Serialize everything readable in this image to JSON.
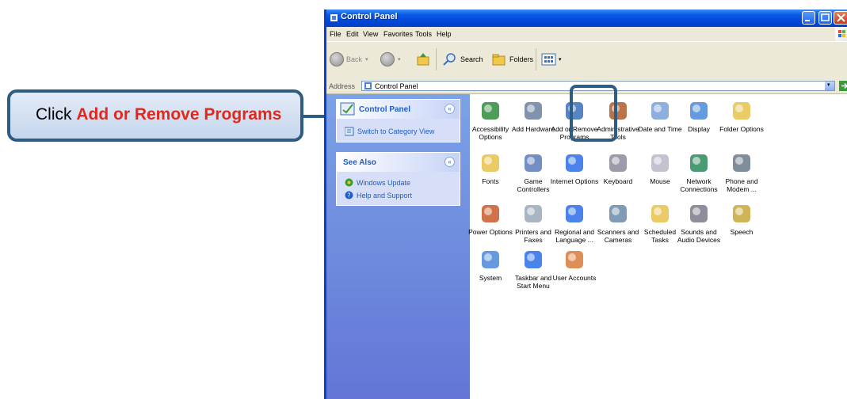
{
  "window": {
    "title": "Control Panel",
    "menus": [
      "File",
      "Edit",
      "View",
      "Favorites",
      "Tools",
      "Help"
    ],
    "toolbar": {
      "back": "Back",
      "search": "Search",
      "folders": "Folders"
    },
    "address": {
      "label": "Address",
      "value": "Control Panel",
      "go": "Go"
    }
  },
  "sidebar": {
    "control_panel": {
      "title": "Control Panel",
      "link": "Switch to Category View"
    },
    "see_also": {
      "title": "See Also",
      "links": [
        "Windows Update",
        "Help and Support"
      ]
    }
  },
  "items": [
    {
      "label": "Accessibility Options",
      "icon": "accessibility-icon"
    },
    {
      "label": "Add Hardware",
      "icon": "add-hardware-icon"
    },
    {
      "label": "Add or Remove Programs",
      "icon": "add-remove-programs-icon"
    },
    {
      "label": "Administrative Tools",
      "icon": "administrative-tools-icon"
    },
    {
      "label": "Date and Time",
      "icon": "clock-icon"
    },
    {
      "label": "Display",
      "icon": "display-icon"
    },
    {
      "label": "Folder Options",
      "icon": "folder-options-icon"
    },
    {
      "label": "Fonts",
      "icon": "fonts-folder-icon"
    },
    {
      "label": "Game Controllers",
      "icon": "joystick-icon"
    },
    {
      "label": "Internet Options",
      "icon": "globe-icon"
    },
    {
      "label": "Keyboard",
      "icon": "keyboard-icon"
    },
    {
      "label": "Mouse",
      "icon": "mouse-icon"
    },
    {
      "label": "Network Connections",
      "icon": "network-icon"
    },
    {
      "label": "Phone and Modem ...",
      "icon": "phone-icon"
    },
    {
      "label": "Power Options",
      "icon": "power-icon"
    },
    {
      "label": "Printers and Faxes",
      "icon": "printer-icon"
    },
    {
      "label": "Regional and Language ...",
      "icon": "regional-globe-icon"
    },
    {
      "label": "Scanners and Cameras",
      "icon": "scanner-icon"
    },
    {
      "label": "Scheduled Tasks",
      "icon": "scheduled-tasks-icon"
    },
    {
      "label": "Sounds and Audio Devices",
      "icon": "speaker-icon"
    },
    {
      "label": "Speech",
      "icon": "speech-icon"
    },
    {
      "label": "System",
      "icon": "system-icon"
    },
    {
      "label": "Taskbar and Start Menu",
      "icon": "taskbar-icon"
    },
    {
      "label": "User Accounts",
      "icon": "users-icon"
    }
  ],
  "callout": {
    "prefix": "Click ",
    "highlight": "Add or Remove Programs"
  },
  "colors": {
    "accent_blue": "#0a5ae8",
    "callout_border": "#2e5d84",
    "highlight_red": "#e0281c"
  }
}
